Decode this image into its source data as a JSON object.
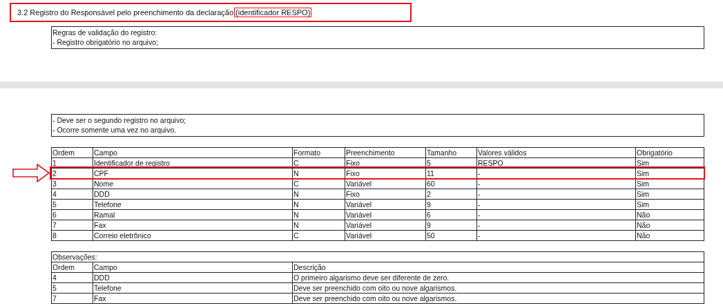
{
  "section_title": {
    "text": "3.2 Registro do Responsável pelo preenchimento da declaração",
    "identifier": "(identificador RESPO)"
  },
  "validation_rules": [
    "Regras de validação do registro:",
    "- Registro obrigatório no arquivo;"
  ],
  "notes": [
    "- Deve ser o segundo registro no arquivo;",
    "- Ocorre somente uma vez no arquivo."
  ],
  "fields_table": {
    "columns": [
      "Ordem",
      "Campo",
      "Formato",
      "Preenchimento",
      "Tamanho",
      "Valores válidos",
      "Obrigatório"
    ],
    "rows": [
      {
        "cells": [
          "1",
          "Identificador de registro",
          "C",
          "Fixo",
          "5",
          "RESPO",
          "Sim"
        ],
        "highlighted": false
      },
      {
        "cells": [
          "2",
          "CPF",
          "N",
          "Fixo",
          "11",
          "-",
          "Sim"
        ],
        "highlighted": true
      },
      {
        "cells": [
          "3",
          "Nome",
          "C",
          "Variável",
          "60",
          "-",
          "Sim"
        ],
        "highlighted": false
      },
      {
        "cells": [
          "4",
          "DDD",
          "N",
          "Fixo",
          "2",
          "-",
          "Sim"
        ],
        "highlighted": false
      },
      {
        "cells": [
          "5",
          "Telefone",
          "N",
          "Variável",
          "9",
          "-",
          "Sim"
        ],
        "highlighted": false
      },
      {
        "cells": [
          "6",
          "Ramal",
          "N",
          "Variável",
          "6",
          "-",
          "Não"
        ],
        "highlighted": false
      },
      {
        "cells": [
          "7",
          "Fax",
          "N",
          "Variável",
          "9",
          "-",
          "Não"
        ],
        "highlighted": false
      },
      {
        "cells": [
          "8",
          "Correio eletrônico",
          "C",
          "Variável",
          "50",
          "-",
          "Não"
        ],
        "highlighted": false
      }
    ]
  },
  "observations_table": {
    "title": "Observações:",
    "columns": [
      "Ordem",
      "Campo",
      "Descrição"
    ],
    "rows": [
      [
        "4",
        "DDD",
        "O primeiro algarismo deve ser diferente de zero."
      ],
      [
        "5",
        "Telefone",
        "Deve ser preenchido com oito ou nove algarismos."
      ],
      [
        "7",
        "Fax",
        "Deve ser preenchido com oito ou nove algarismos."
      ]
    ]
  }
}
